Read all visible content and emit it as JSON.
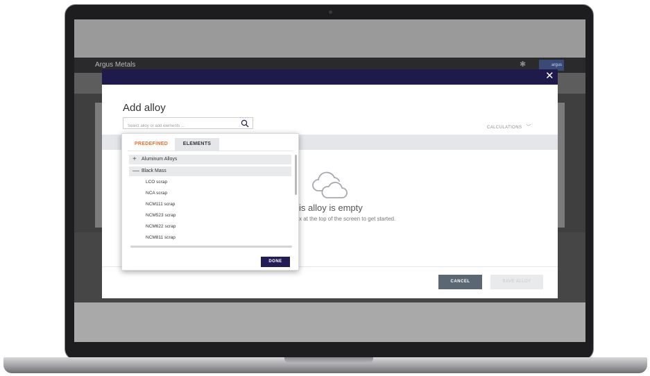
{
  "app": {
    "brand": "Argus Metals",
    "logo_text": "argus"
  },
  "modal": {
    "title": "Add alloy",
    "search_placeholder": "Select alloy or add elements ...",
    "calculations_label": "CALCULATIONS",
    "empty_title": "is alloy is empty",
    "empty_message": "x at the top of the screen to get started.",
    "cancel_label": "CANCEL",
    "save_label": "SAVE ALLOY"
  },
  "dropdown": {
    "tabs": [
      {
        "label": "PREDEFINED",
        "active": true
      },
      {
        "label": "ELEMENTS",
        "active": false
      }
    ],
    "groups": [
      {
        "label": "Aluminum Alloys",
        "expanded": false,
        "sign": "+"
      },
      {
        "label": "Black Mass",
        "expanded": true,
        "sign": "—"
      }
    ],
    "items": [
      "LCO scrap",
      "NCA scrap",
      "NCM111 scrap",
      "NCM523 scrap",
      "NCM622 scrap",
      "NCM811 scrap"
    ],
    "done_label": "DONE"
  },
  "colors": {
    "header_bar": "#1e1a4b",
    "active_tab": "#e8712a",
    "done_button": "#231d56",
    "cancel_button": "#5c6774"
  }
}
